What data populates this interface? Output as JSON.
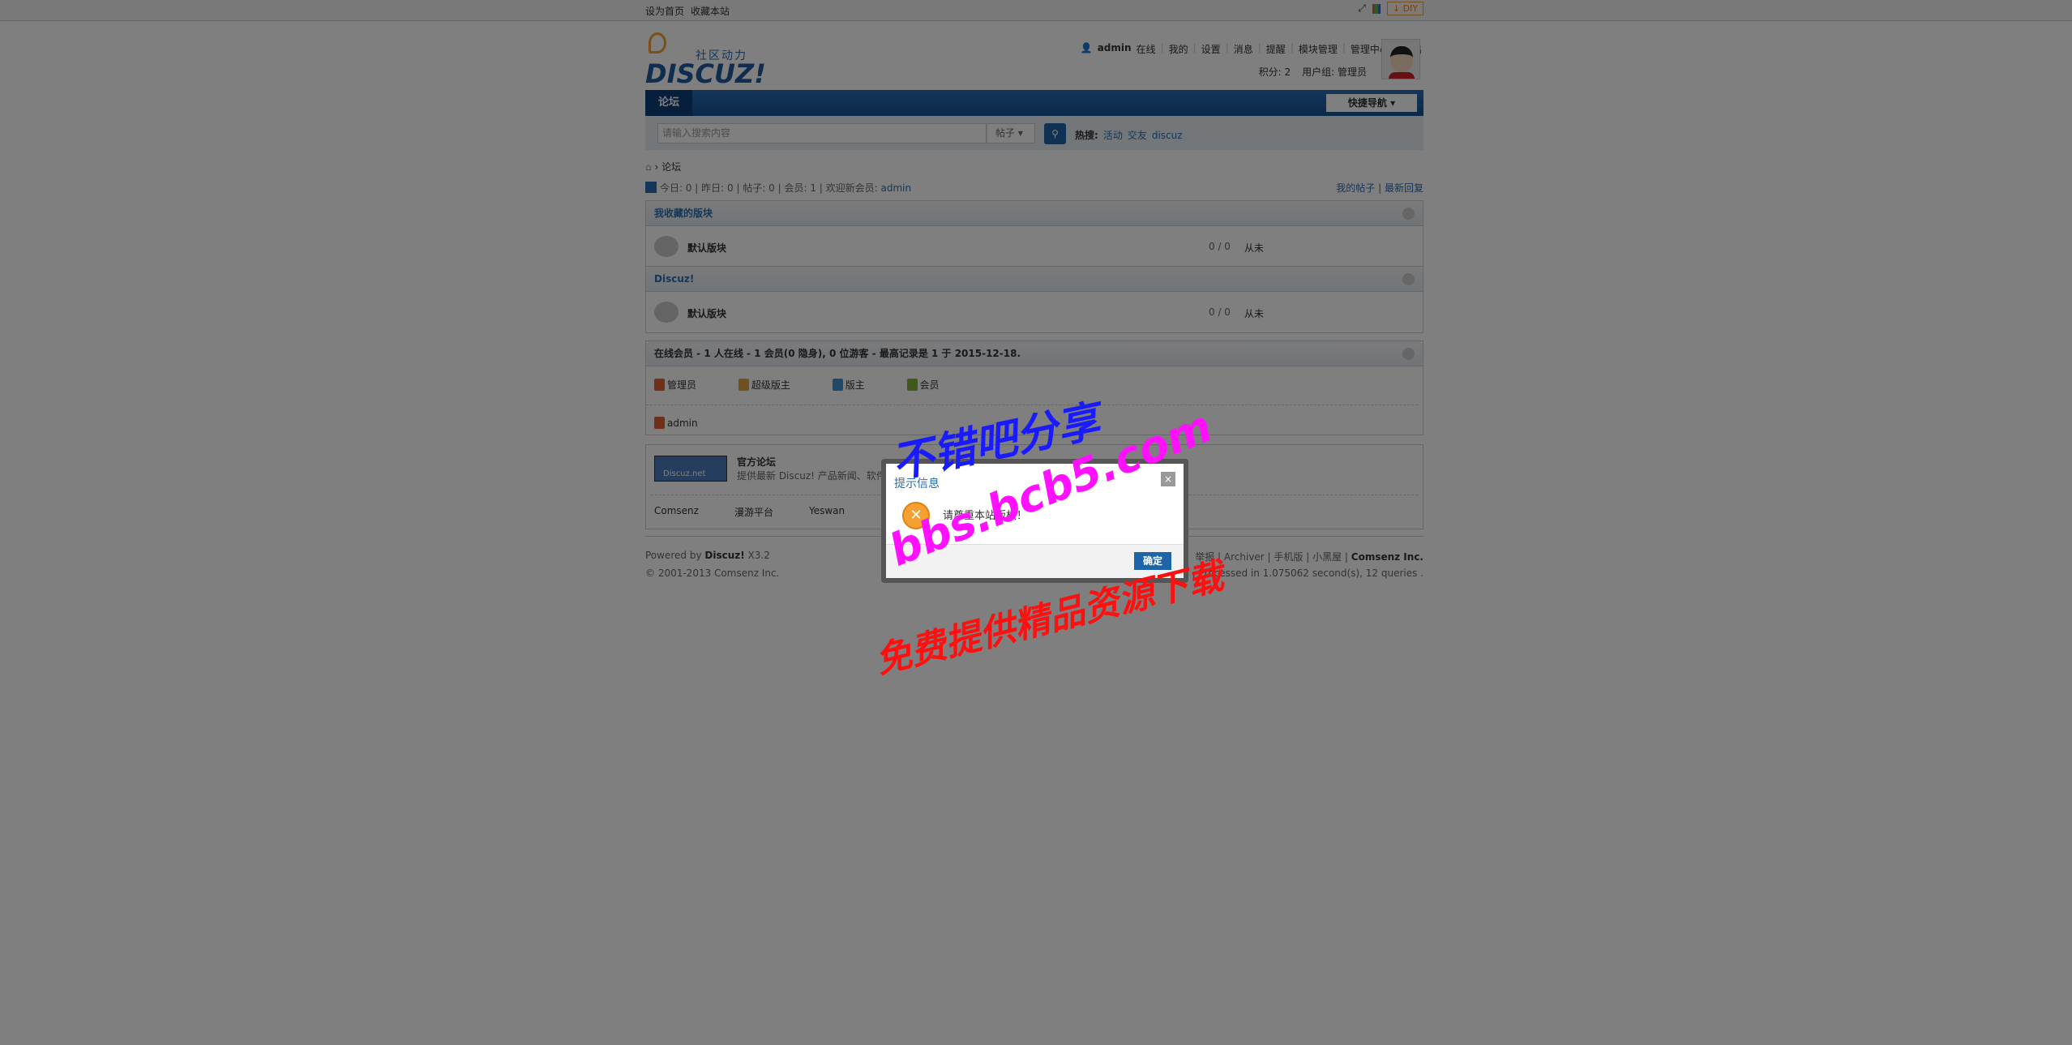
{
  "topbar": {
    "set_home": "设为首页",
    "bookmark": "收藏本站",
    "diy": "DIY"
  },
  "logo": {
    "tagline": "社区动力",
    "name": "DISCUZ!"
  },
  "user": {
    "name": "admin",
    "status": "在线",
    "menu": [
      "我的",
      "设置",
      "消息",
      "提醒",
      "模块管理",
      "管理中心",
      "退出"
    ],
    "credits": "积分: 2",
    "group": "用户组: 管理员"
  },
  "nav": {
    "current": "论坛",
    "quick_nav": "快捷导航 ▾"
  },
  "search": {
    "placeholder": "请输入搜索内容",
    "type": "帖子",
    "hot_label": "热搜:",
    "hot": [
      "活动",
      "交友",
      "discuz"
    ]
  },
  "breadcrumb": {
    "current": "论坛"
  },
  "stats": {
    "text": "今日: 0 | 昨日: 0 | 帖子: 0 | 会员: 1 | 欢迎新会员: ",
    "new_member": "admin",
    "my_posts": "我的帖子",
    "latest": "最新回复"
  },
  "categories": [
    {
      "title": "我收藏的版块",
      "forums": [
        {
          "name": "默认版块",
          "count": "0 / 0",
          "last": "从未"
        }
      ]
    },
    {
      "title": "Discuz!",
      "forums": [
        {
          "name": "默认版块",
          "count": "0 / 0",
          "last": "从未"
        }
      ]
    }
  ],
  "online": {
    "title": "在线会员 - 1 人在线 - 1 会员(0 隐身), 0 位游客 - 最高记录是 1 于 2015-12-18.",
    "legend": [
      "管理员",
      "超级版主",
      "版主",
      "会员"
    ],
    "legend_colors": [
      "#e06030",
      "#e0a040",
      "#4090d0",
      "#80b030"
    ],
    "users": [
      "admin"
    ]
  },
  "links": {
    "logo_text": "Discuz.net",
    "title": "官方论坛",
    "desc": "提供最新 Discuz! 产品新闻、软件下",
    "items": [
      "Comsenz",
      "漫游平台",
      "Yeswan"
    ]
  },
  "footer": {
    "powered": "Powered by ",
    "product": "Discuz!",
    "version": " X3.2",
    "copyright": "© 2001-2013 Comsenz Inc.",
    "links": "举报 | Archiver | 手机版 | 小黑屋 | ",
    "company": "Comsenz Inc.",
    "process": "6:17 , Processed in 1.075062 second(s), 12 queries ."
  },
  "dialog": {
    "title": "提示信息",
    "message": "请尊重本站版权！",
    "ok": "确定",
    "close": "×"
  },
  "watermark": [
    "不错吧分享",
    "bbs.bcb5.com",
    "免费提供精品资源下载"
  ]
}
